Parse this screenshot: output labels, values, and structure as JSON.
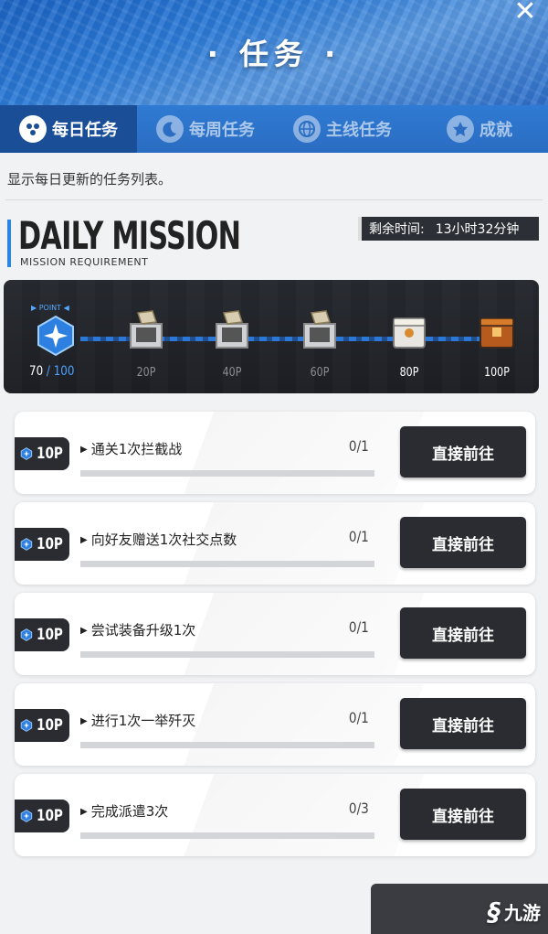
{
  "header": {
    "title": "· 任务 ·"
  },
  "tabs": [
    {
      "label": "每日任务",
      "icon": "daily-icon",
      "active": true
    },
    {
      "label": "每周任务",
      "icon": "moon-icon",
      "active": false
    },
    {
      "label": "主线任务",
      "icon": "globe-icon",
      "active": false
    },
    {
      "label": "成就",
      "icon": "star-icon",
      "active": false
    }
  ],
  "subtitle": "显示每日更新的任务列表。",
  "daily": {
    "title": "DAILY MISSION",
    "subtitle": "MISSION REQUIREMENT",
    "timer_label": "剩余时间:",
    "timer_value": "13小时32分钟"
  },
  "progress": {
    "point_label": "▶ POINT ◀",
    "current": "70",
    "separator": " / ",
    "max": "100",
    "milestones": [
      {
        "label": "20P",
        "claimed": true
      },
      {
        "label": "40P",
        "claimed": true
      },
      {
        "label": "60P",
        "claimed": true
      },
      {
        "label": "80P",
        "claimed": false
      },
      {
        "label": "100P",
        "claimed": false
      }
    ]
  },
  "missions": [
    {
      "reward": "10P",
      "name": "通关1次拦截战",
      "count": "0/1",
      "button": "直接前往"
    },
    {
      "reward": "10P",
      "name": "向好友赠送1次社交点数",
      "count": "0/1",
      "button": "直接前往"
    },
    {
      "reward": "10P",
      "name": "尝试装备升级1次",
      "count": "0/1",
      "button": "直接前往"
    },
    {
      "reward": "10P",
      "name": "进行1次一举歼灭",
      "count": "0/1",
      "button": "直接前往"
    },
    {
      "reward": "10P",
      "name": "完成派遣3次",
      "count": "0/3",
      "button": "直接前往"
    }
  ],
  "watermark": {
    "text": "九游"
  },
  "colors": {
    "accent": "#2a86e0",
    "dark": "#2a2c31",
    "header_blue": "#2c7ad6"
  }
}
